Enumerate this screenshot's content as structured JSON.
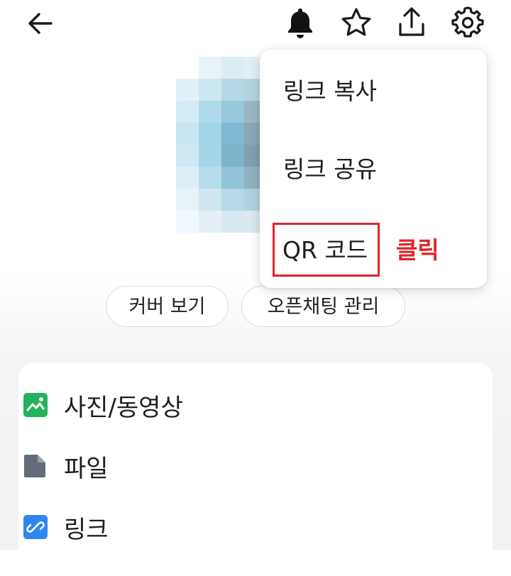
{
  "header": {
    "back_icon": "arrow-left-icon",
    "actions": [
      {
        "icon": "bell-icon"
      },
      {
        "icon": "star-icon"
      },
      {
        "icon": "share-upload-icon"
      },
      {
        "icon": "gear-icon"
      }
    ]
  },
  "profile": {
    "avatar": "blurred-profile-image"
  },
  "buttons": {
    "cover": "커버 보기",
    "manage": "오픈채팅 관리"
  },
  "menu": {
    "items": [
      {
        "label": "링크 복사"
      },
      {
        "label": "링크 공유"
      },
      {
        "label": "QR 코드"
      }
    ]
  },
  "annotation": {
    "click": "클릭",
    "color": "#e0242a"
  },
  "drawer": {
    "items": [
      {
        "label": "사진/동영상",
        "icon": "photo-icon",
        "color": "#23b35a"
      },
      {
        "label": "파일",
        "icon": "file-icon",
        "color": "#646b79"
      },
      {
        "label": "링크",
        "icon": "link-icon",
        "color": "#2f86f2"
      }
    ]
  }
}
